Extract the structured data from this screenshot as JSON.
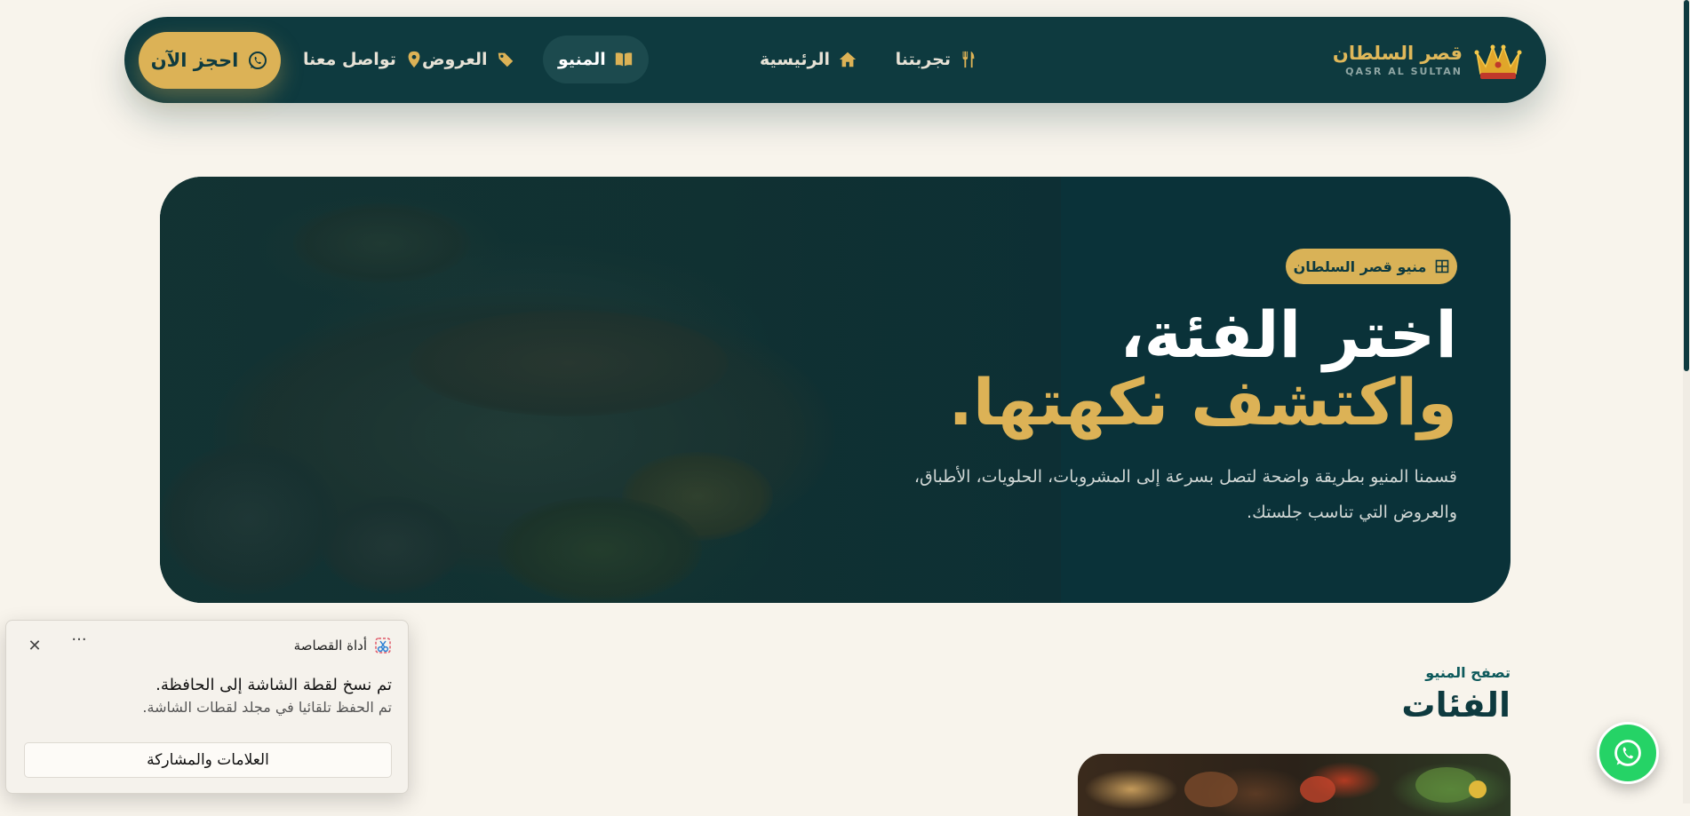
{
  "brand": {
    "name": "قصر السلطان",
    "latin": "QASR AL SULTAN"
  },
  "nav": {
    "items": [
      {
        "label": "الرئيسية",
        "icon": "home-icon"
      },
      {
        "label": "تجربتنا",
        "icon": "utensils-icon"
      },
      {
        "label": "المنيو",
        "icon": "book-open-icon",
        "active": true
      },
      {
        "label": "العروض",
        "icon": "tags-icon"
      },
      {
        "label": "تواصل معنا",
        "icon": "map-pin-icon"
      }
    ],
    "cta_label": "احجز الآن",
    "cta_icon": "whatsapp-icon"
  },
  "hero": {
    "badge": "منيو قصر السلطان",
    "badge_icon": "grid-icon",
    "title_line1": "اختر الفئة،",
    "title_line2": "واكتشف نكهتها.",
    "description": "قسمنا المنيو بطريقة واضحة لتصل بسرعة إلى المشروبات، الحلويات، الأطباق، والعروض التي تناسب جلستك."
  },
  "categories": {
    "eyebrow": "تصفح المنيو",
    "title": "الفئات"
  },
  "toast": {
    "app_name": "أداة القصاصة",
    "title": "تم نسخ لقطة الشاشة إلى الحافظة.",
    "subtitle": "تم الحفظ تلقائيا في مجلد لقطات الشاشة.",
    "button": "العلامات والمشاركة",
    "more": "···",
    "close": "✕"
  },
  "colors": {
    "primary": "#0e3a3f",
    "accent": "#dcb256",
    "background": "#f8f4ec",
    "whatsapp": "#25d366"
  }
}
